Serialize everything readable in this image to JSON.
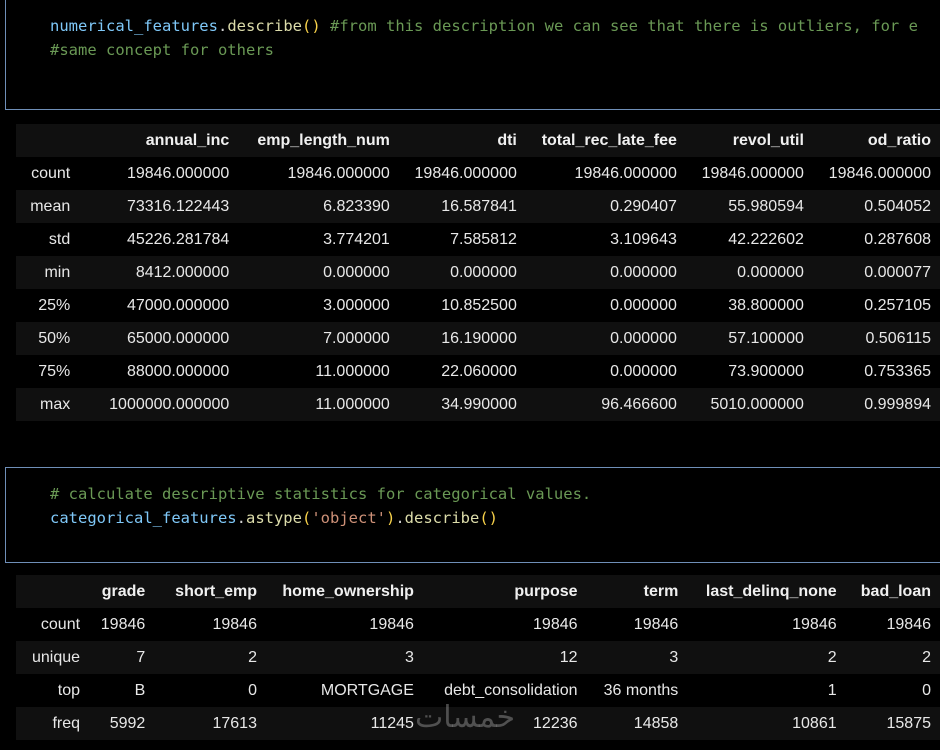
{
  "cell1": {
    "line1": {
      "var": "numerical_features",
      "fn": "describe",
      "comment": "#from this description we can see that there is outliers, for e"
    },
    "line2": {
      "comment": "#same concept for others"
    }
  },
  "table1": {
    "columns": [
      "",
      "annual_inc",
      "emp_length_num",
      "dti",
      "total_rec_late_fee",
      "revol_util",
      "od_ratio"
    ],
    "rows": [
      [
        "count",
        "19846.000000",
        "19846.000000",
        "19846.000000",
        "19846.000000",
        "19846.000000",
        "19846.000000"
      ],
      [
        "mean",
        "73316.122443",
        "6.823390",
        "16.587841",
        "0.290407",
        "55.980594",
        "0.504052"
      ],
      [
        "std",
        "45226.281784",
        "3.774201",
        "7.585812",
        "3.109643",
        "42.222602",
        "0.287608"
      ],
      [
        "min",
        "8412.000000",
        "0.000000",
        "0.000000",
        "0.000000",
        "0.000000",
        "0.000077"
      ],
      [
        "25%",
        "47000.000000",
        "3.000000",
        "10.852500",
        "0.000000",
        "38.800000",
        "0.257105"
      ],
      [
        "50%",
        "65000.000000",
        "7.000000",
        "16.190000",
        "0.000000",
        "57.100000",
        "0.506115"
      ],
      [
        "75%",
        "88000.000000",
        "11.000000",
        "22.060000",
        "0.000000",
        "73.900000",
        "0.753365"
      ],
      [
        "max",
        "1000000.000000",
        "11.000000",
        "34.990000",
        "96.466600",
        "5010.000000",
        "0.999894"
      ]
    ]
  },
  "cell2": {
    "line1": {
      "comment": "# calculate descriptive statistics for categorical values."
    },
    "line2": {
      "var": "categorical_features",
      "fn1": "astype",
      "str": "'object'",
      "fn2": "describe"
    }
  },
  "table2": {
    "columns": [
      "",
      "grade",
      "short_emp",
      "home_ownership",
      "purpose",
      "term",
      "last_delinq_none",
      "bad_loan"
    ],
    "rows": [
      [
        "count",
        "19846",
        "19846",
        "19846",
        "19846",
        "19846",
        "19846",
        "19846"
      ],
      [
        "unique",
        "7",
        "2",
        "3",
        "12",
        "3",
        "2",
        "2"
      ],
      [
        "top",
        "B",
        "0",
        "MORTGAGE",
        "debt_consolidation",
        "36 months",
        "1",
        "0"
      ],
      [
        "freq",
        "5992",
        "17613",
        "11245",
        "12236",
        "14858",
        "10861",
        "15875"
      ]
    ]
  },
  "watermark": "خمسات"
}
